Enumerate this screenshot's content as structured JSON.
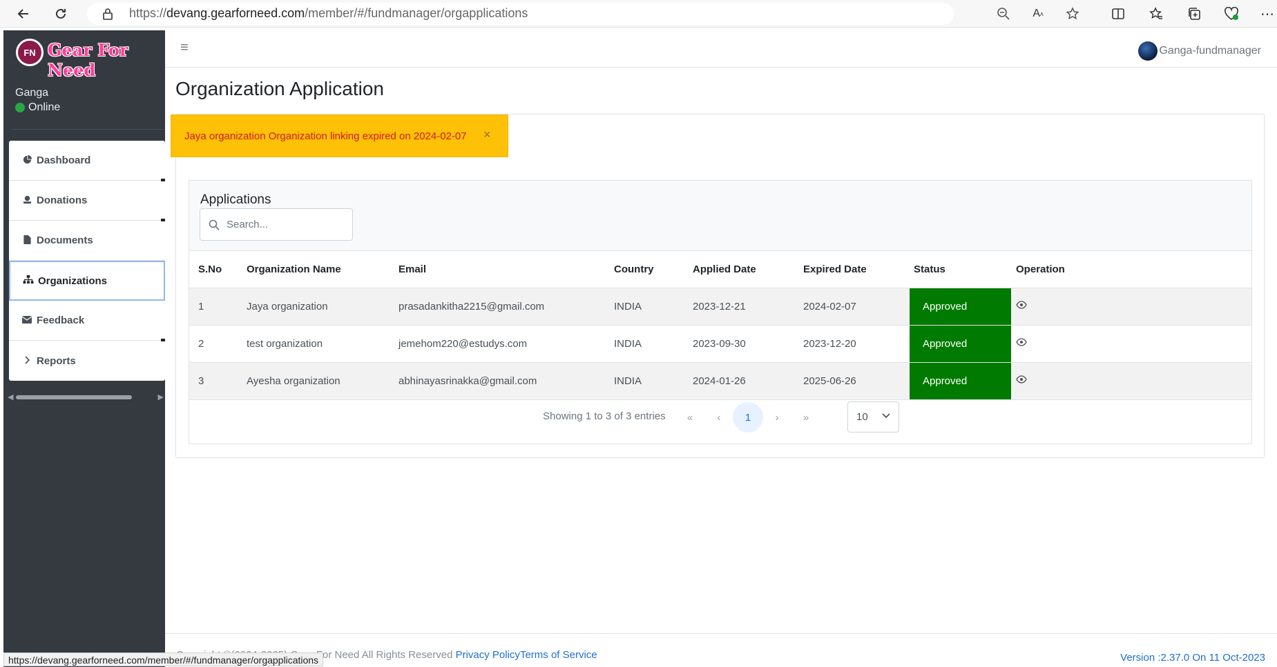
{
  "browser": {
    "url_prefix": "https://",
    "url_host": "devang.gearforneed.com",
    "url_path": "/member/#/fundmanager/orgapplications",
    "status_url": "https://devang.gearforneed.com/member/#/fundmanager/orgapplications"
  },
  "sidebar": {
    "logo_badge": "FN",
    "logo_text": "Gear For Need",
    "user_name": "Ganga",
    "user_status": "Online",
    "items": [
      {
        "label": "Dashboard",
        "icon": "pie-chart-icon"
      },
      {
        "label": "Donations",
        "icon": "donate-icon"
      },
      {
        "label": "Documents",
        "icon": "file-icon"
      },
      {
        "label": "Organizations",
        "icon": "sitemap-icon"
      },
      {
        "label": "Feedback",
        "icon": "envelope-icon"
      },
      {
        "label": "Reports",
        "icon": "chevron-right-icon"
      }
    ],
    "active_item": "Organizations"
  },
  "navbar": {
    "user_label": "Ganga-fundmanager"
  },
  "page": {
    "title": "Organization Application",
    "alert_text": "Jaya organization Organization linking expired on 2024-02-07",
    "alert_close": "×"
  },
  "applications": {
    "title": "Applications",
    "search_placeholder": "Search...",
    "columns": [
      "S.No",
      "Organization Name",
      "Email",
      "Country",
      "Applied Date",
      "Expired Date",
      "Status",
      "Operation"
    ],
    "rows": [
      {
        "sno": "1",
        "name": "Jaya organization",
        "email": "prasadankitha2215@gmail.com",
        "country": "INDIA",
        "applied": "2023-12-21",
        "expired": "2024-02-07",
        "status": "Approved"
      },
      {
        "sno": "2",
        "name": "test organization",
        "email": "jemehom220@estudys.com",
        "country": "INDIA",
        "applied": "2023-09-30",
        "expired": "2023-12-20",
        "status": "Approved"
      },
      {
        "sno": "3",
        "name": "Ayesha organization",
        "email": "abhinayasrinakka@gmail.com",
        "country": "INDIA",
        "applied": "2024-01-26",
        "expired": "2025-06-26",
        "status": "Approved"
      }
    ],
    "pager_info": "Showing 1 to 3 of 3 entries",
    "first": "«",
    "prev": "‹",
    "current_page": "1",
    "next": "›",
    "last": "»",
    "page_size": "10"
  },
  "footer": {
    "copyright": "Copyright ©(2024-2025) Gear For Need All Rights Reserved ",
    "privacy": "Privacy Policy",
    "terms": "Terms of Service",
    "version": "Version :2.37.0 On 11 Oct-2023"
  },
  "colors": {
    "sidebar_bg": "#343a40",
    "alert_bg": "#ffc107",
    "alert_text": "#d11a1a",
    "approved_bg": "#007a00",
    "link": "#1d6fd1"
  }
}
